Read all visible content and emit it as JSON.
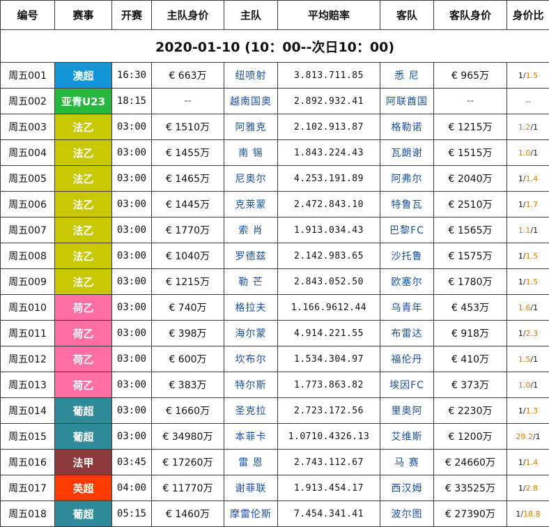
{
  "header": {
    "col_code": "编号",
    "col_league": "赛事",
    "col_time": "开赛",
    "col_home_value": "主队身价",
    "col_home": "主队",
    "col_odds": "平均赔率",
    "col_away": "客队",
    "col_away_value": "客队身价",
    "col_ratio": "身价比"
  },
  "date_label": "2020-01-10 (10：00--次日10：00)",
  "league_colors": {
    "澳超": "#1296d8",
    "亚青U23": "#26b83f",
    "法乙": "#c8c800",
    "荷乙": "#ff6fa3",
    "葡超": "#2f8a99",
    "法甲": "#8a3a3a",
    "英超": "#ff3a00"
  },
  "rows": [
    {
      "code": "周五001",
      "league": "澳超",
      "time": "16:30",
      "home_value": "€ 663万",
      "home": "纽喷射",
      "odds": "3.813.711.85",
      "away": "悉 尼",
      "away_value": "€ 965万",
      "ratio_left": "1",
      "ratio_right": "1.5",
      "hl": "right"
    },
    {
      "code": "周五002",
      "league": "亚青U23",
      "time": "18:15",
      "home_value": "--",
      "home": "越南国奥",
      "odds": "2.892.932.41",
      "away": "阿联酋国",
      "away_value": "--",
      "ratio_left": "--",
      "ratio_right": "",
      "hl": "none"
    },
    {
      "code": "周五003",
      "league": "法乙",
      "time": "03:00",
      "home_value": "€ 1510万",
      "home": "阿雅克",
      "odds": "2.102.913.87",
      "away": "格勒诺",
      "away_value": "€ 1215万",
      "ratio_left": "1.2",
      "ratio_right": "1",
      "hl": "left"
    },
    {
      "code": "周五004",
      "league": "法乙",
      "time": "03:00",
      "home_value": "€ 1455万",
      "home": "南 锡",
      "odds": "1.843.224.43",
      "away": "瓦朗谢",
      "away_value": "€ 1515万",
      "ratio_left": "1.0",
      "ratio_right": "1",
      "hl": "left"
    },
    {
      "code": "周五005",
      "league": "法乙",
      "time": "03:00",
      "home_value": "€ 1465万",
      "home": "尼奥尔",
      "odds": "4.253.191.89",
      "away": "阿弗尔",
      "away_value": "€ 2040万",
      "ratio_left": "1",
      "ratio_right": "1.4",
      "hl": "right"
    },
    {
      "code": "周五006",
      "league": "法乙",
      "time": "03:00",
      "home_value": "€ 1445万",
      "home": "克莱蒙",
      "odds": "2.472.843.10",
      "away": "特鲁瓦",
      "away_value": "€ 2510万",
      "ratio_left": "1",
      "ratio_right": "1.7",
      "hl": "right"
    },
    {
      "code": "周五007",
      "league": "法乙",
      "time": "03:00",
      "home_value": "€ 1770万",
      "home": "索 肖",
      "odds": "1.913.034.43",
      "away": "巴黎FC",
      "away_value": "€ 1565万",
      "ratio_left": "1.1",
      "ratio_right": "1",
      "hl": "left"
    },
    {
      "code": "周五008",
      "league": "法乙",
      "time": "03:00",
      "home_value": "€ 1040万",
      "home": "罗德兹",
      "odds": "2.142.983.65",
      "away": "沙托鲁",
      "away_value": "€ 1575万",
      "ratio_left": "1",
      "ratio_right": "1.5",
      "hl": "right"
    },
    {
      "code": "周五009",
      "league": "法乙",
      "time": "03:00",
      "home_value": "€ 1215万",
      "home": "勒 芒",
      "odds": "2.843.052.50",
      "away": "欧塞尔",
      "away_value": "€ 1780万",
      "ratio_left": "1",
      "ratio_right": "1.5",
      "hl": "right"
    },
    {
      "code": "周五010",
      "league": "荷乙",
      "time": "03:00",
      "home_value": "€ 740万",
      "home": "格拉夫",
      "odds": "1.166.9612.44",
      "away": "乌青年",
      "away_value": "€ 453万",
      "ratio_left": "1.6",
      "ratio_right": "1",
      "hl": "left"
    },
    {
      "code": "周五011",
      "league": "荷乙",
      "time": "03:00",
      "home_value": "€ 398万",
      "home": "海尔蒙",
      "odds": "4.914.221.55",
      "away": "布雷达",
      "away_value": "€ 918万",
      "ratio_left": "1",
      "ratio_right": "2.3",
      "hl": "right"
    },
    {
      "code": "周五012",
      "league": "荷乙",
      "time": "03:00",
      "home_value": "€ 600万",
      "home": "坎布尔",
      "odds": "1.534.304.97",
      "away": "福伦丹",
      "away_value": "€ 410万",
      "ratio_left": "1.5",
      "ratio_right": "1",
      "hl": "left"
    },
    {
      "code": "周五013",
      "league": "荷乙",
      "time": "03:00",
      "home_value": "€ 383万",
      "home": "特尔斯",
      "odds": "1.773.863.82",
      "away": "埃因FC",
      "away_value": "€ 373万",
      "ratio_left": "1.0",
      "ratio_right": "1",
      "hl": "left"
    },
    {
      "code": "周五014",
      "league": "葡超",
      "time": "03:00",
      "home_value": "€ 1660万",
      "home": "圣克拉",
      "odds": "2.723.172.56",
      "away": "里奥阿",
      "away_value": "€ 2230万",
      "ratio_left": "1",
      "ratio_right": "1.3",
      "hl": "right"
    },
    {
      "code": "周五015",
      "league": "葡超",
      "time": "03:00",
      "home_value": "€ 34980万",
      "home": "本菲卡",
      "odds": "1.0710.4326.13",
      "away": "艾维斯",
      "away_value": "€ 1200万",
      "ratio_left": "29.2",
      "ratio_right": "1",
      "hl": "left"
    },
    {
      "code": "周五016",
      "league": "法甲",
      "time": "03:45",
      "home_value": "€ 17260万",
      "home": "雷 恩",
      "odds": "2.743.112.67",
      "away": "马 赛",
      "away_value": "€ 24660万",
      "ratio_left": "1",
      "ratio_right": "1.4",
      "hl": "right"
    },
    {
      "code": "周五017",
      "league": "英超",
      "time": "04:00",
      "home_value": "€ 11770万",
      "home": "谢菲联",
      "odds": "1.913.454.17",
      "away": "西汉姆",
      "away_value": "€ 33525万",
      "ratio_left": "1",
      "ratio_right": "2.8",
      "hl": "right"
    },
    {
      "code": "周五018",
      "league": "葡超",
      "time": "05:15",
      "home_value": "€ 1460万",
      "home": "摩雷伦斯",
      "odds": "7.454.341.41",
      "away": "波尔图",
      "away_value": "€ 27390万",
      "ratio_left": "1",
      "ratio_right": "18.8",
      "hl": "right"
    }
  ]
}
